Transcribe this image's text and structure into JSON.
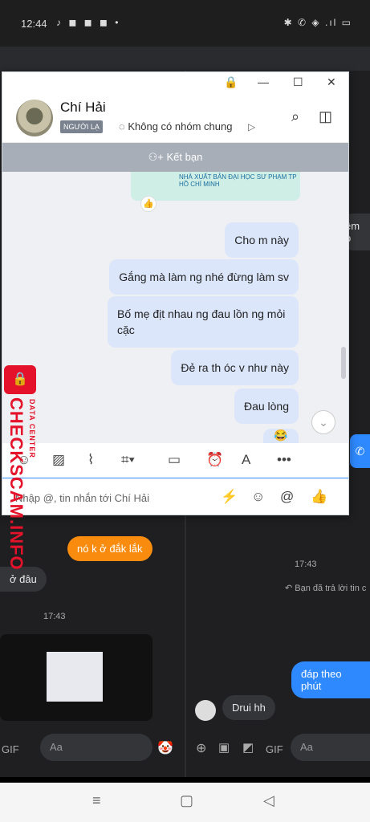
{
  "status_bar": {
    "time": "12:44",
    "left_icons": "♪ ◼ ◼ ◼ •",
    "right_icons": "✱ ✆ ◈ .ıl ▭"
  },
  "popup": {
    "titlebar": {
      "lock": "🔒",
      "minimize": "—",
      "maximize": "☐",
      "close": "✕"
    },
    "contact_name": "Chí Hải",
    "badge": "NGƯỜI LẠ",
    "group_info": "Không có nhóm chung",
    "add_friend": "Kết bạn",
    "card_logo_text": "NHÀ XUẤT BẢN ĐẠI HỌC SƯ PHẠM TP HỒ CHÍ MINH",
    "messages": [
      {
        "text": "Cho m này"
      },
      {
        "text": "Gắng mà làm ng nhé đừng làm sv"
      },
      {
        "text": "Bố mẹ địt nhau ng đau lồn ng mỏi cặc"
      },
      {
        "text": "Đẻ ra th óc v như này"
      },
      {
        "text": "Đau lòng"
      }
    ],
    "input_placeholder": "Nhập @, tin nhắn tới Chí Hải"
  },
  "background_chat": {
    "left_orange": "nó k ở đắk lắk",
    "left_dark": "ở đâu",
    "left_time": "17:43",
    "right_time": "17:43",
    "right_reply": "Bạn đã trả lời tin c",
    "right_blue": "đáp theo phút",
    "right_dark": "Drui hh",
    "right_partial": "ềm b",
    "composer_left": "Aa",
    "composer_right": "Aa"
  },
  "watermark": {
    "main": "CHECKSCAM.INFO",
    "small": "DATA CENTER"
  }
}
